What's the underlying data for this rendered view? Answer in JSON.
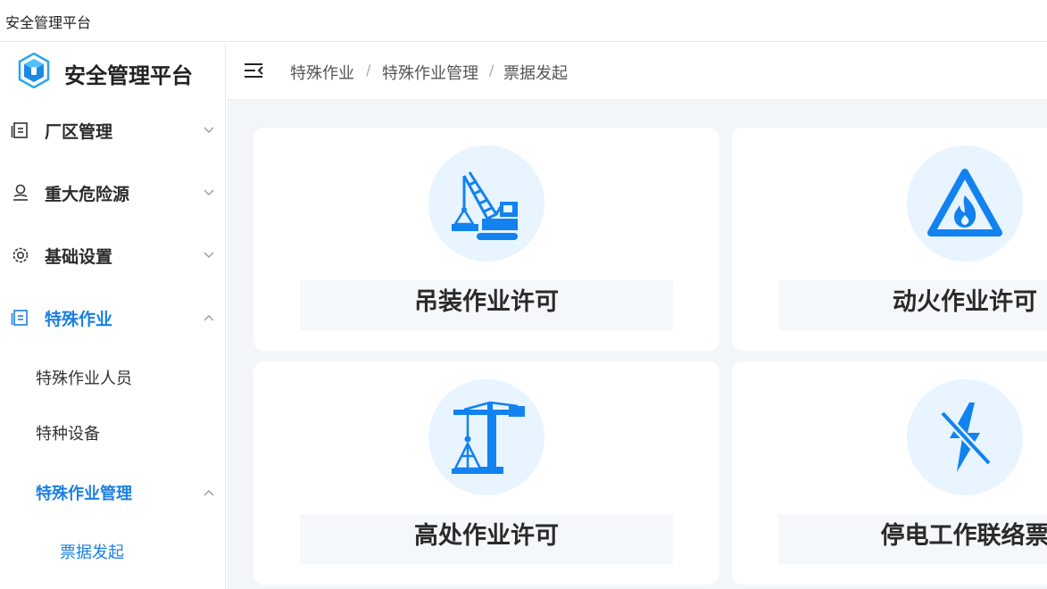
{
  "window": {
    "title": "安全管理平台"
  },
  "sidebar": {
    "brand": "安全管理平台",
    "menu": [
      {
        "label": "厂区管理",
        "icon": "document-icon",
        "expanded": false
      },
      {
        "label": "重大危险源",
        "icon": "person-icon",
        "expanded": false
      },
      {
        "label": "基础设置",
        "icon": "gear-icon",
        "expanded": false
      },
      {
        "label": "特殊作业",
        "icon": "document-icon",
        "expanded": true
      }
    ],
    "submenu": [
      {
        "label": "特殊作业人员"
      },
      {
        "label": "特种设备"
      },
      {
        "label": "特殊作业管理",
        "expanded": true
      }
    ],
    "leaf": {
      "label": "票据发起"
    }
  },
  "header": {
    "breadcrumb": [
      "特殊作业",
      "特殊作业管理",
      "票据发起"
    ],
    "separator": "/"
  },
  "cards": [
    {
      "label": "吊装作业许可",
      "icon": "crane-icon"
    },
    {
      "label": "动火作业许可",
      "icon": "fire-warning-icon"
    },
    {
      "label": "高处作业许可",
      "icon": "tower-crane-icon"
    },
    {
      "label": "停电工作联络票",
      "icon": "power-off-icon"
    }
  ],
  "colors": {
    "accent": "#1a7fe6",
    "icon_blue": "#1282f0",
    "circle_bg": "#e8f4ff",
    "content_bg": "#f3f6f9"
  }
}
